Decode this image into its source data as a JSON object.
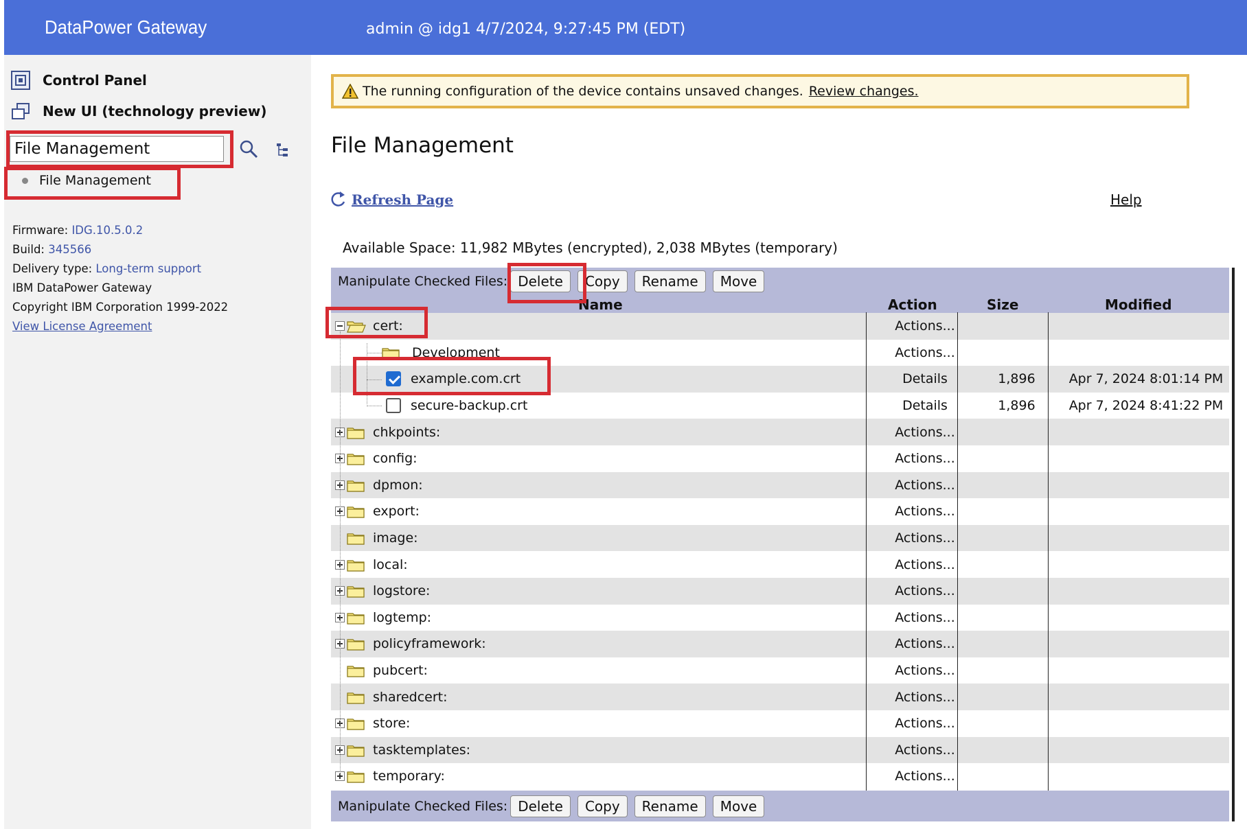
{
  "header": {
    "app_title": "DataPower Gateway",
    "session": "admin @ idg1 4/7/2024, 9:27:45 PM (EDT)",
    "bg_color": "#4a6fd8"
  },
  "sidebar": {
    "nav": [
      {
        "label": "Control Panel",
        "icon": "control-panel-icon"
      },
      {
        "label": "New UI (technology preview)",
        "icon": "new-ui-icon"
      }
    ],
    "search_value": "File Management",
    "search_results": [
      "File Management"
    ],
    "info": {
      "firmware_label": "Firmware:",
      "firmware_value": "IDG.10.5.0.2",
      "build_label": "Build:",
      "build_value": "345566",
      "delivery_label": "Delivery type:",
      "delivery_value": "Long-term support",
      "product": "IBM DataPower Gateway",
      "copyright": "Copyright IBM Corporation 1999-2022",
      "license_link": "View License Agreement"
    }
  },
  "warning": {
    "text": "The running configuration of the device contains unsaved changes.",
    "link": "Review changes."
  },
  "page_title": "File Management",
  "refresh_label": "Refresh Page",
  "help_label": "Help",
  "available_space": "Available Space: 11,982 MBytes (encrypted), 2,038 MBytes (temporary)",
  "toolbar": {
    "label": "Manipulate Checked Files:",
    "buttons": [
      "Delete",
      "Copy",
      "Rename",
      "Move"
    ]
  },
  "columns": [
    "Name",
    "Action",
    "Size",
    "Modified"
  ],
  "rows": [
    {
      "name": "cert:",
      "type": "folder-open",
      "expander": "minus",
      "action": "Actions...",
      "size": "",
      "modified": ""
    },
    {
      "name": "Development",
      "type": "folder-child",
      "expander": "",
      "action": "Actions...",
      "size": "",
      "modified": ""
    },
    {
      "name": "example.com.crt",
      "type": "file",
      "checked": true,
      "action": "Details",
      "size": "1,896",
      "modified": "Apr 7, 2024 8:01:14 PM"
    },
    {
      "name": "secure-backup.crt",
      "type": "file",
      "checked": false,
      "action": "Details",
      "size": "1,896",
      "modified": "Apr 7, 2024 8:41:22 PM"
    },
    {
      "name": "chkpoints:",
      "type": "folder",
      "expander": "plus",
      "action": "Actions...",
      "size": "",
      "modified": ""
    },
    {
      "name": "config:",
      "type": "folder",
      "expander": "plus",
      "action": "Actions...",
      "size": "",
      "modified": ""
    },
    {
      "name": "dpmon:",
      "type": "folder",
      "expander": "plus",
      "action": "Actions...",
      "size": "",
      "modified": ""
    },
    {
      "name": "export:",
      "type": "folder",
      "expander": "plus",
      "action": "Actions...",
      "size": "",
      "modified": ""
    },
    {
      "name": "image:",
      "type": "folder",
      "expander": "",
      "action": "Actions...",
      "size": "",
      "modified": ""
    },
    {
      "name": "local:",
      "type": "folder",
      "expander": "plus",
      "action": "Actions...",
      "size": "",
      "modified": ""
    },
    {
      "name": "logstore:",
      "type": "folder",
      "expander": "plus",
      "action": "Actions...",
      "size": "",
      "modified": ""
    },
    {
      "name": "logtemp:",
      "type": "folder",
      "expander": "plus",
      "action": "Actions...",
      "size": "",
      "modified": ""
    },
    {
      "name": "policyframework:",
      "type": "folder",
      "expander": "plus",
      "action": "Actions...",
      "size": "",
      "modified": ""
    },
    {
      "name": "pubcert:",
      "type": "folder",
      "expander": "",
      "action": "Actions...",
      "size": "",
      "modified": ""
    },
    {
      "name": "sharedcert:",
      "type": "folder",
      "expander": "",
      "action": "Actions...",
      "size": "",
      "modified": ""
    },
    {
      "name": "store:",
      "type": "folder",
      "expander": "plus",
      "action": "Actions...",
      "size": "",
      "modified": ""
    },
    {
      "name": "tasktemplates:",
      "type": "folder",
      "expander": "plus",
      "action": "Actions...",
      "size": "",
      "modified": ""
    },
    {
      "name": "temporary:",
      "type": "folder",
      "expander": "plus",
      "action": "Actions...",
      "size": "",
      "modified": ""
    }
  ],
  "highlight_color": "#d62b32"
}
